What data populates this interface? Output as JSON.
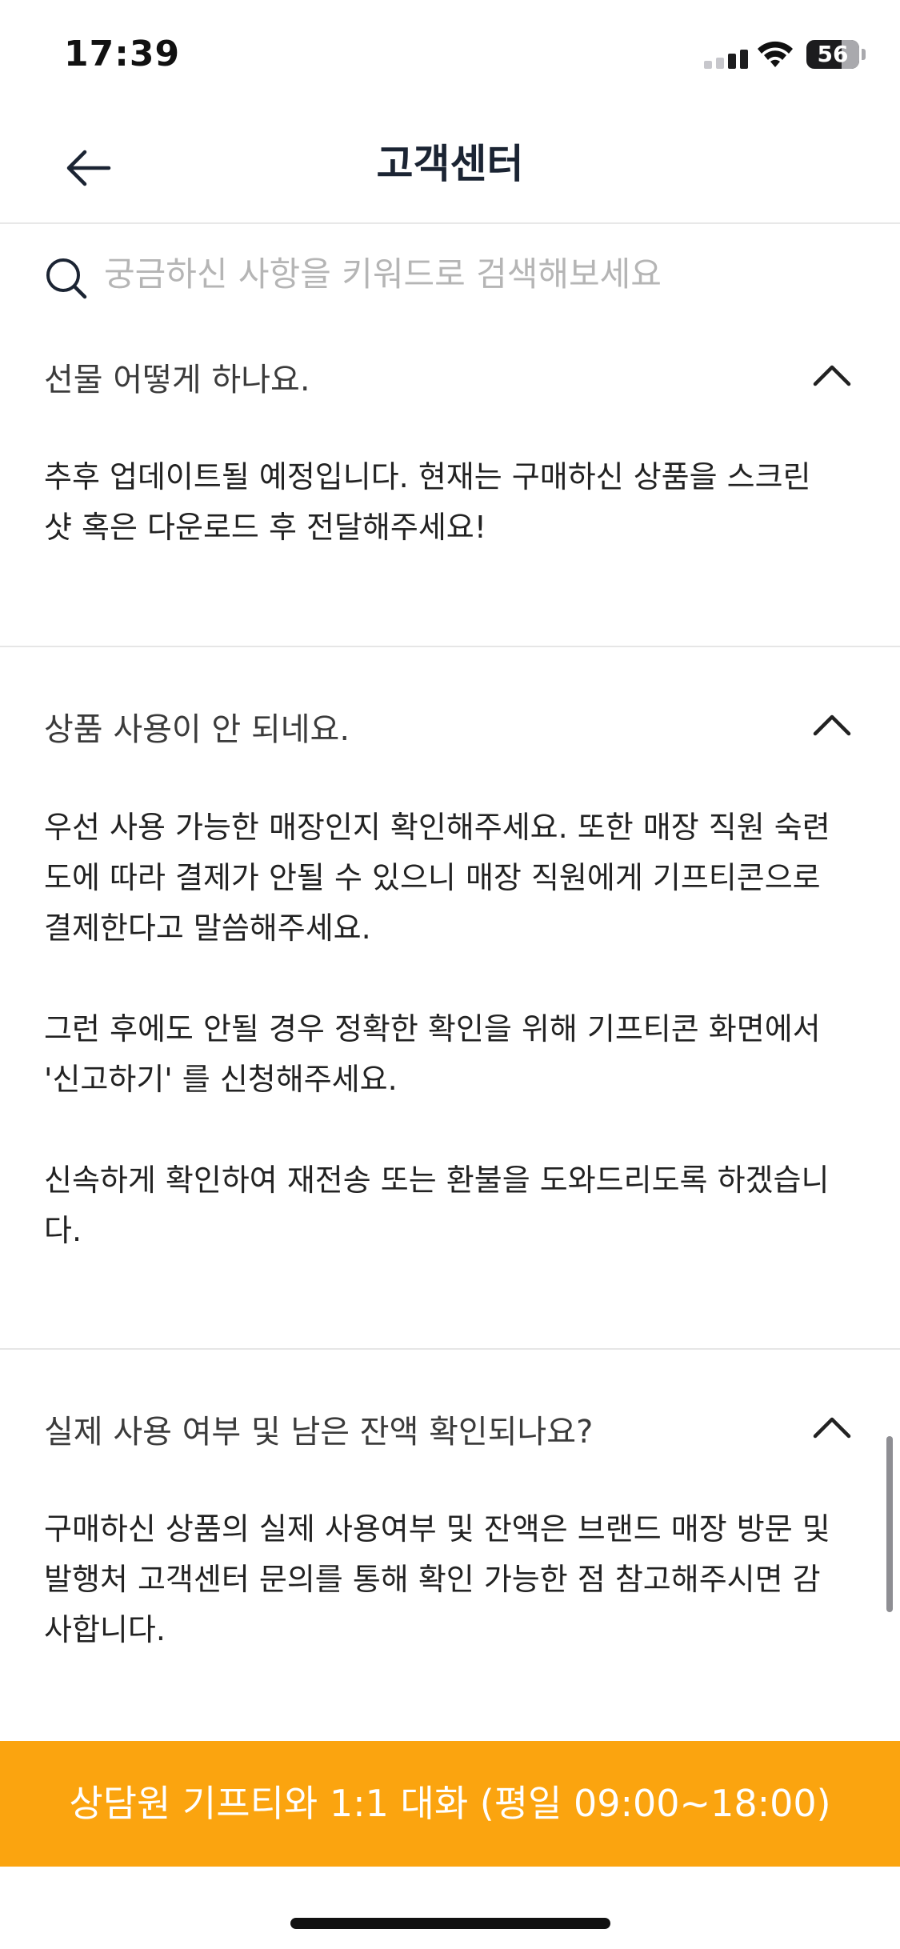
{
  "status_bar": {
    "time": "17:39",
    "battery_level": "56",
    "icons": [
      "signal-icon",
      "wifi-icon",
      "battery-icon"
    ]
  },
  "header": {
    "title": "고객센터",
    "back_icon": "arrow-left-icon"
  },
  "search": {
    "placeholder": "궁금하신 사항을 키워드로 검색해보세요",
    "value": "",
    "icon": "search-icon"
  },
  "faq": [
    {
      "question": "선물 어떻게 하나요.",
      "answer": "추후 업데이트될 예정입니다. 현재는 구매하신 상품을 스크린\n샷 혹은 다운로드 후 전달해주세요!",
      "expanded": true
    },
    {
      "question": "상품 사용이 안 되네요.",
      "answer": "우선 사용 가능한 매장인지 확인해주세요. 또한 매장 직원 숙련\n도에 따라 결제가 안될 수 있으니 매장 직원에게 기프티콘으로\n결제한다고 말씀해주세요.\n\n그런 후에도 안될 경우 정확한 확인을 위해 기프티콘 화면에서\n'신고하기' 를 신청해주세요.\n\n신속하게 확인하여 재전송 또는 환불을 도와드리도록 하겠습니\n다.",
      "expanded": true
    },
    {
      "question": "실제 사용 여부 및 남은 잔액 확인되나요?",
      "answer": "구매하신 상품의 실제 사용여부 및 잔액은 브랜드 매장 방문 및\n발행처 고객센터 문의를 통해 확인 가능한 점 참고해주시면 감\n사합니다.",
      "expanded": true
    }
  ],
  "cta": {
    "label": "상담원 기프티와 1:1 대화 (평일 09:00~18:00)"
  },
  "colors": {
    "accent": "#fba40f",
    "title": "#1b2433",
    "divider": "#e6e6e6",
    "placeholder": "#b5b5b5"
  }
}
